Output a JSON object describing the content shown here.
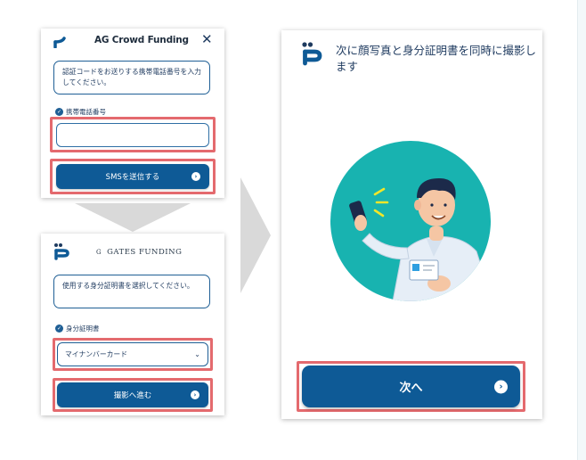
{
  "flow": {
    "step1": {
      "brand": "AG Crowd Funding",
      "close_icon": "close-icon",
      "message": "認証コードをお送りする携帯電話番号を入力してください。",
      "field_label": "携帯電話番号",
      "phone_value": "",
      "button_label": "SMSを送信する"
    },
    "step2": {
      "brand_mark": "G",
      "brand": "GATES FUNDING",
      "message": "使用する身分証明書を選択してください。",
      "field_label": "身分証明書",
      "selected_document": "マイナンバーカード",
      "button_label": "撮影へ進む"
    },
    "step3": {
      "title": "次に顔写真と身分証明書を同時に撮影します",
      "button_label": "次へ"
    }
  },
  "colors": {
    "primary": "#0e5a96",
    "highlight": "#e46a6e",
    "illustration_bg": "#18b3b0",
    "arrow_gray": "#d9d9d9"
  },
  "icons": [
    "p-logo-icon",
    "close-icon",
    "check-icon",
    "chevron-down-icon",
    "arrow-right-icon",
    "down-arrow-icon",
    "right-arrow-icon"
  ]
}
